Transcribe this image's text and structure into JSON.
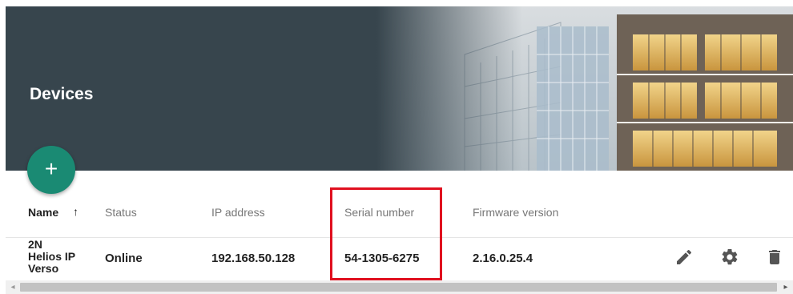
{
  "header": {
    "title": "Devices"
  },
  "fab": {
    "label": "+"
  },
  "table": {
    "columns": [
      "Name",
      "Status",
      "IP address",
      "Serial number",
      "Firmware version"
    ],
    "sort_indicator": "↑",
    "rows": [
      {
        "name_lines": [
          "2N",
          "Helios IP",
          "Verso"
        ],
        "status": "Online",
        "ip": "192.168.50.128",
        "serial": "54-1305-6275",
        "firmware": "2.16.0.25.4"
      }
    ]
  },
  "row_actions": [
    "pencil-icon",
    "gear-icon",
    "trash-icon"
  ],
  "scrollbar": {
    "left_arrow": "◂",
    "right_arrow": "▸"
  },
  "colors": {
    "header_bg": "#37454d",
    "fab": "#1a8a73",
    "highlight": "#e0101f"
  }
}
